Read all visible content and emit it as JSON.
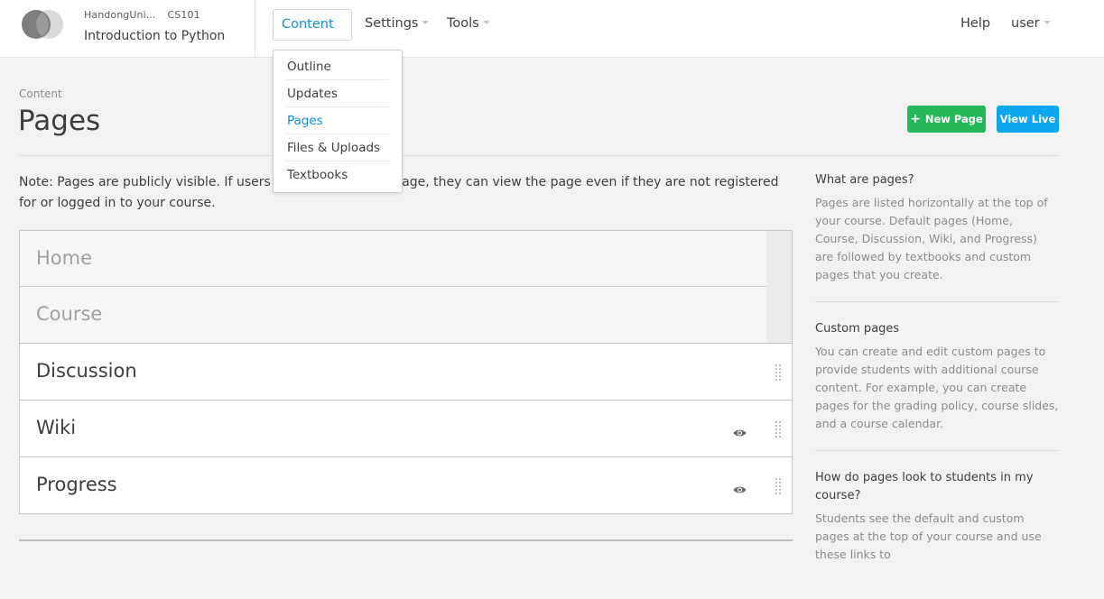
{
  "header": {
    "org": "HandongUni...",
    "course_number": "CS101",
    "course_title": "Introduction to Python",
    "nav": {
      "content": "Content",
      "settings": "Settings",
      "tools": "Tools",
      "help": "Help",
      "user": "user"
    }
  },
  "dropdown": {
    "items": [
      "Outline",
      "Updates",
      "Pages",
      "Files & Uploads",
      "Textbooks"
    ],
    "active": "Pages"
  },
  "page": {
    "subtitle": "Content",
    "title": "Pages",
    "new_page_label": "New Page",
    "view_live_label": "View Live",
    "note": "Note: Pages are publicly visible. If users know the URL of a page, they can view the page even if they are not registered for or logged in to your course."
  },
  "pages": [
    {
      "name": "Home",
      "locked": true
    },
    {
      "name": "Course",
      "locked": true
    },
    {
      "name": "Discussion",
      "locked": false
    },
    {
      "name": "Wiki",
      "locked": false,
      "visibility_icon": "eye-icon"
    },
    {
      "name": "Progress",
      "locked": false,
      "visibility_icon": "eye-icon"
    }
  ],
  "sidebar": {
    "sections": [
      {
        "title": "What are pages?",
        "body": "Pages are listed horizontally at the top of your course. Default pages (Home, Course, Discussion, Wiki, and Progress) are followed by textbooks and custom pages that you create."
      },
      {
        "title": "Custom pages",
        "body": "You can create and edit custom pages to provide students with additional course content. For example, you can create pages for the grading policy, course slides, and a course calendar."
      },
      {
        "title": "How do pages look to students in my course?",
        "body": "Students see the default and custom pages at the top of your course and use these links to"
      }
    ]
  },
  "colors": {
    "accent_blue": "#0e8ee0",
    "new_page_green": "#25b85a",
    "view_live_blue": "#0ea6ec"
  }
}
